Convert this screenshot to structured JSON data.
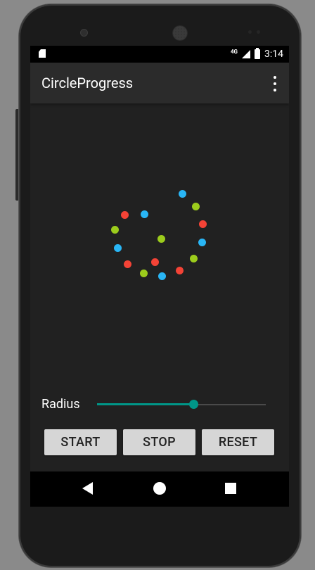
{
  "status_bar": {
    "network": "4G",
    "time": "3:14"
  },
  "app_bar": {
    "title": "CircleProgress",
    "overflow_icon": "more-vert-icon"
  },
  "progress_dots": {
    "colors": {
      "red": "#f44336",
      "green": "#9ccc1c",
      "blue": "#29b6f6"
    }
  },
  "radius": {
    "label": "Radius",
    "value_fraction": 0.57,
    "accent": "#009688"
  },
  "buttons": {
    "start": "START",
    "stop": "STOP",
    "reset": "RESET"
  },
  "nav_bar": {
    "back_icon": "back-icon",
    "home_icon": "home-icon",
    "recent_icon": "recents-icon"
  }
}
